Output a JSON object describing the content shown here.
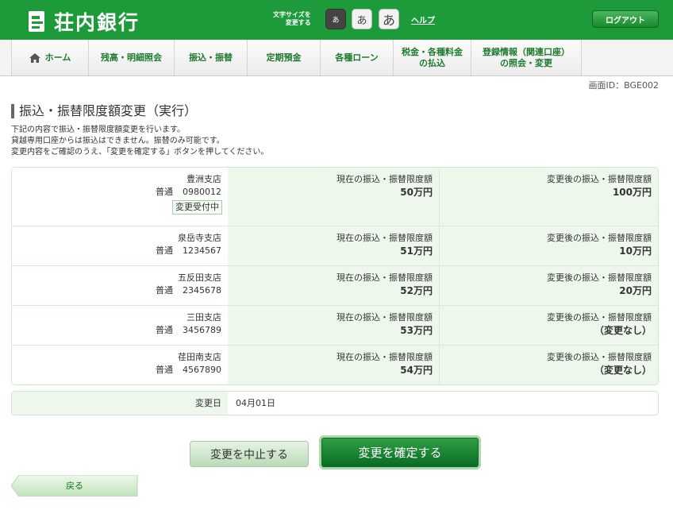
{
  "header": {
    "bank_name": "荘内銀行",
    "fontsize_label_line1": "文字サイズを",
    "fontsize_label_line2": "変更する",
    "fontsize_options": [
      "あ",
      "あ",
      "あ"
    ],
    "help": "ヘルプ",
    "logout": "ログアウト"
  },
  "nav": {
    "items": [
      {
        "label": "ホーム",
        "icon": "home-icon"
      },
      {
        "label": "残高・明細照会"
      },
      {
        "label": "振込・振替"
      },
      {
        "label": "定期預金"
      },
      {
        "label": "各種ローン"
      },
      {
        "label_line1": "税金・各種料金",
        "label_line2": "の払込"
      },
      {
        "label_line1": "登録情報（関連口座）",
        "label_line2": "の照会・変更"
      }
    ]
  },
  "screen_id": "画面ID：BGE002",
  "page_title": "振込・振替限度額変更（実行）",
  "description": [
    "下記の内容で振込・振替限度額変更を行います。",
    "貸越専用口座からは振込はできません。振替のみ可能です。",
    "変更内容をご確認のうえ、「変更を確定する」ボタンを押してください。"
  ],
  "table": {
    "current_label": "現在の振込・振替限度額",
    "new_label": "変更後の振込・振替限度額",
    "rows": [
      {
        "branch": "豊洲支店",
        "type": "普通",
        "account": "0980012",
        "status": "変更受付中",
        "current": "50万円",
        "new": "100万円"
      },
      {
        "branch": "泉岳寺支店",
        "type": "普通",
        "account": "1234567",
        "current": "51万円",
        "new": "10万円"
      },
      {
        "branch": "五反田支店",
        "type": "普通",
        "account": "2345678",
        "current": "52万円",
        "new": "20万円"
      },
      {
        "branch": "三田支店",
        "type": "普通",
        "account": "3456789",
        "current": "53万円",
        "new": "（変更なし）"
      },
      {
        "branch": "荏田南支店",
        "type": "普通",
        "account": "4567890",
        "current": "54万円",
        "new": "（変更なし）"
      }
    ]
  },
  "change_date": {
    "label": "変更日",
    "value": "04月01日"
  },
  "buttons": {
    "cancel": "変更を中止する",
    "confirm": "変更を確定する",
    "back": "戻る"
  },
  "colors": {
    "brand_green": "#1d9a3a",
    "nav_text": "#1d7a2e",
    "row_bg": "#edf7ec"
  }
}
